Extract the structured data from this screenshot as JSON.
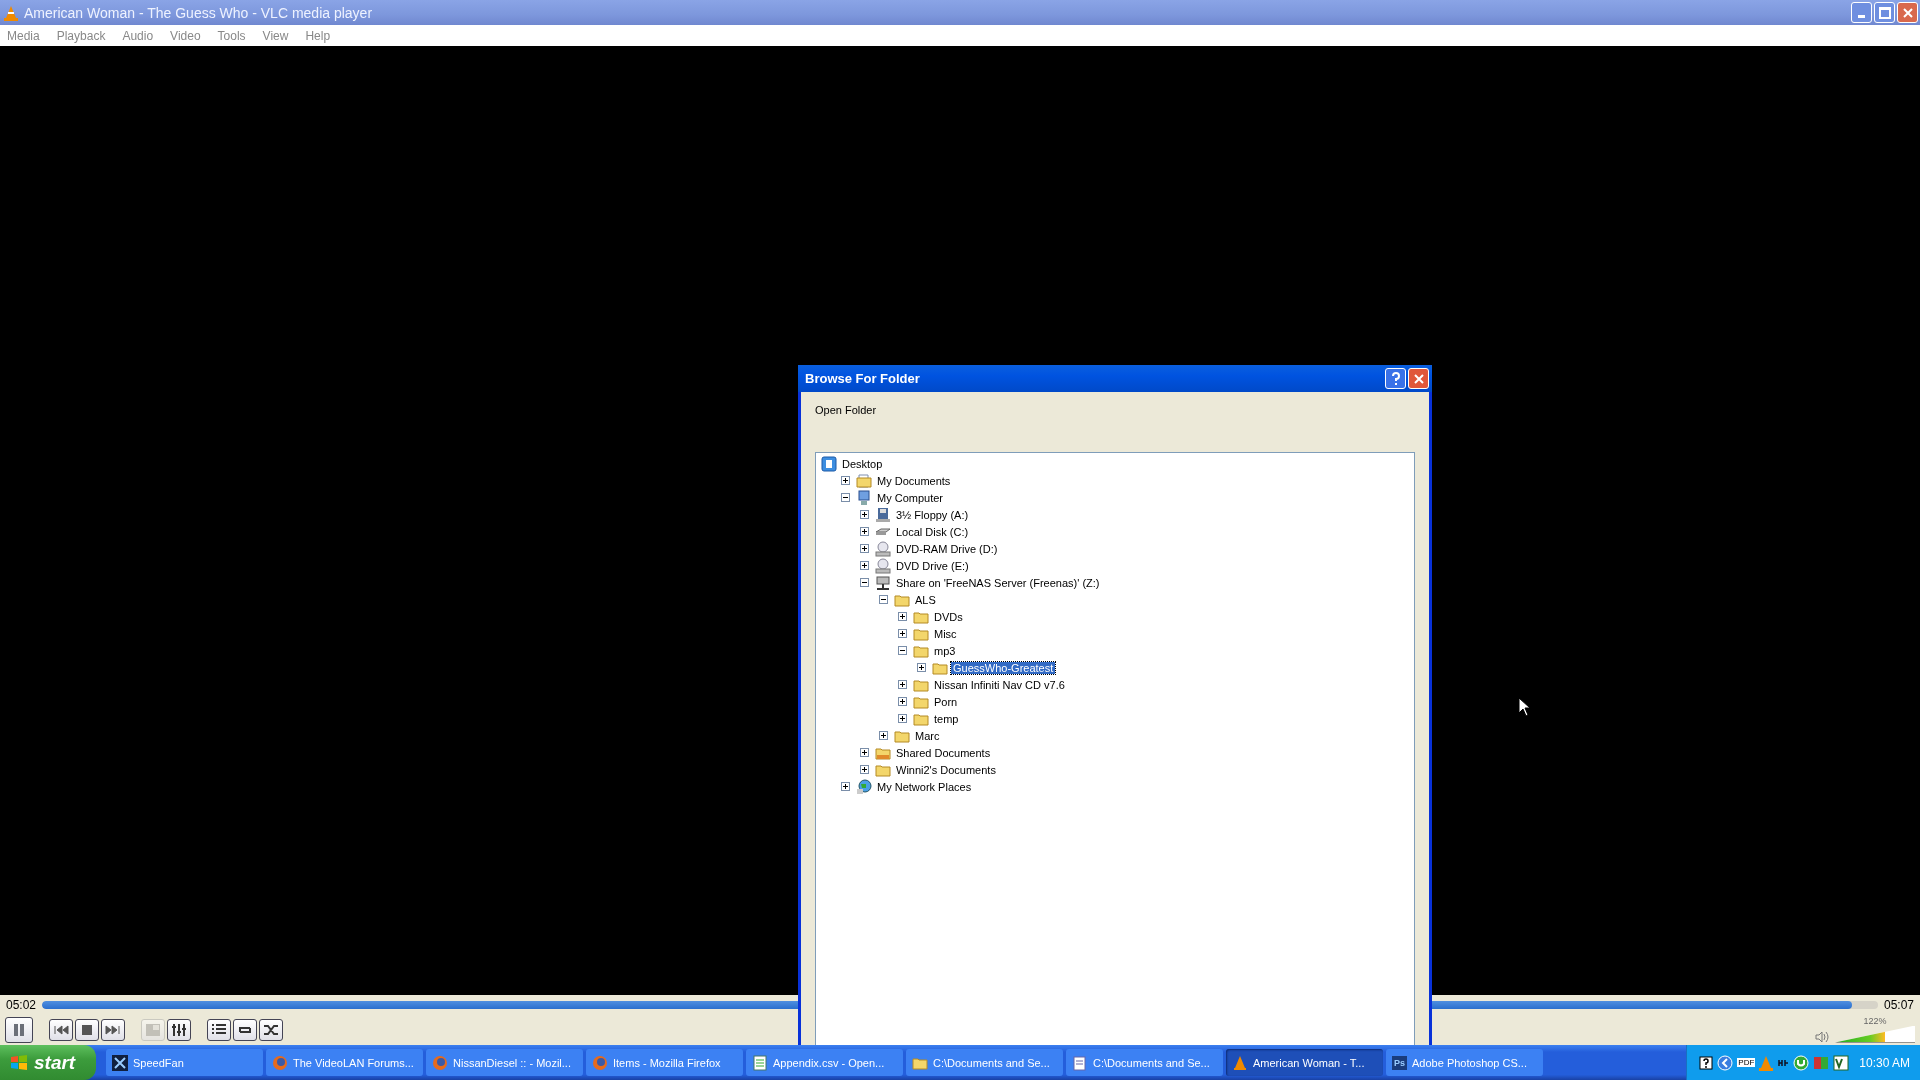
{
  "window": {
    "title": "American Woman - The Guess Who - VLC media player"
  },
  "menu": [
    "Media",
    "Playback",
    "Audio",
    "Video",
    "Tools",
    "View",
    "Help"
  ],
  "player": {
    "elapsed": "05:02",
    "total": "05:07",
    "level": 0.986,
    "controls": [
      {
        "kind": "pause",
        "disabled": false
      },
      {
        "kind": "previous",
        "disabled": false
      },
      {
        "kind": "stop",
        "disabled": false
      },
      {
        "kind": "next",
        "disabled": false
      },
      {
        "kind": "fullscreen",
        "disabled": true
      },
      {
        "kind": "equalizer",
        "disabled": false
      },
      {
        "kind": "playlist",
        "disabled": false
      },
      {
        "kind": "loop",
        "disabled": false
      },
      {
        "kind": "shuffle",
        "disabled": false
      }
    ],
    "volume": {
      "level": 0.62,
      "reading": "122%"
    }
  },
  "dialog": {
    "title": "Browse For Folder",
    "prompt": "Open Folder",
    "tree": [
      {
        "label": "Desktop",
        "kind": "desktop",
        "selected": false,
        "children": [
          {
            "label": "My Documents",
            "kind": "documents",
            "expanded": false,
            "selected": false
          },
          {
            "label": "My Computer",
            "kind": "computer",
            "expanded": true,
            "selected": false,
            "children": [
              {
                "label": "3½ Floppy (A:)",
                "kind": "floppy",
                "expanded": false,
                "selected": false
              },
              {
                "label": "Local Disk (C:)",
                "kind": "disk",
                "expanded": false,
                "selected": false
              },
              {
                "label": "DVD-RAM Drive (D:)",
                "kind": "dvd",
                "expanded": false,
                "selected": false
              },
              {
                "label": "DVD Drive (E:)",
                "kind": "dvd",
                "expanded": false,
                "selected": false
              },
              {
                "label": "Share on 'FreeNAS Server (Freenas)' (Z:)",
                "kind": "share",
                "expanded": true,
                "selected": false,
                "children": [
                  {
                    "label": "ALS",
                    "kind": "folder",
                    "expanded": true,
                    "selected": false,
                    "children": [
                      {
                        "label": "DVDs",
                        "kind": "folder",
                        "expanded": false,
                        "selected": false
                      },
                      {
                        "label": "Misc",
                        "kind": "folder",
                        "expanded": false,
                        "selected": false
                      },
                      {
                        "label": "mp3",
                        "kind": "folder",
                        "expanded": true,
                        "selected": false,
                        "children": [
                          {
                            "label": "GuessWho-Greatest",
                            "kind": "folder",
                            "expanded": false,
                            "selected": true
                          }
                        ]
                      },
                      {
                        "label": "Nissan Infiniti Nav CD v7.6",
                        "kind": "folder",
                        "expanded": false,
                        "selected": false
                      },
                      {
                        "label": "Porn",
                        "kind": "folder",
                        "expanded": false,
                        "selected": false
                      },
                      {
                        "label": "temp",
                        "kind": "folder",
                        "expanded": false,
                        "selected": false
                      }
                    ]
                  },
                  {
                    "label": "Marc",
                    "kind": "folder",
                    "expanded": false,
                    "selected": false
                  }
                ]
              },
              {
                "label": "Shared Documents",
                "kind": "shared",
                "expanded": false,
                "selected": false
              },
              {
                "label": "Winni2's Documents",
                "kind": "folder",
                "expanded": false,
                "selected": false
              }
            ]
          },
          {
            "label": "My Network Places",
            "kind": "network",
            "expanded": false,
            "selected": false
          }
        ]
      }
    ]
  },
  "taskbar": {
    "start": "start",
    "items": [
      {
        "label": "SpeedFan",
        "kind": "fan",
        "selected": false
      },
      {
        "label": "The VideoLAN Forums...",
        "kind": "firefox",
        "selected": false
      },
      {
        "label": "NissanDiesel :: - Mozil...",
        "kind": "firefox",
        "selected": false
      },
      {
        "label": "Items - Mozilla Firefox",
        "kind": "firefox",
        "selected": false
      },
      {
        "label": "Appendix.csv - Open...",
        "kind": "sheet",
        "selected": false
      },
      {
        "label": "C:\\Documents and Se...",
        "kind": "folder",
        "selected": false
      },
      {
        "label": "C:\\Documents and Se...",
        "kind": "notepad",
        "selected": false
      },
      {
        "label": "American Woman - T...",
        "kind": "vlc",
        "selected": true
      },
      {
        "label": "Adobe Photoshop CS...",
        "kind": "ps",
        "icon_text": "Ps",
        "selected": false
      }
    ],
    "tray_text": "PDF",
    "clock": "10:30 AM"
  }
}
